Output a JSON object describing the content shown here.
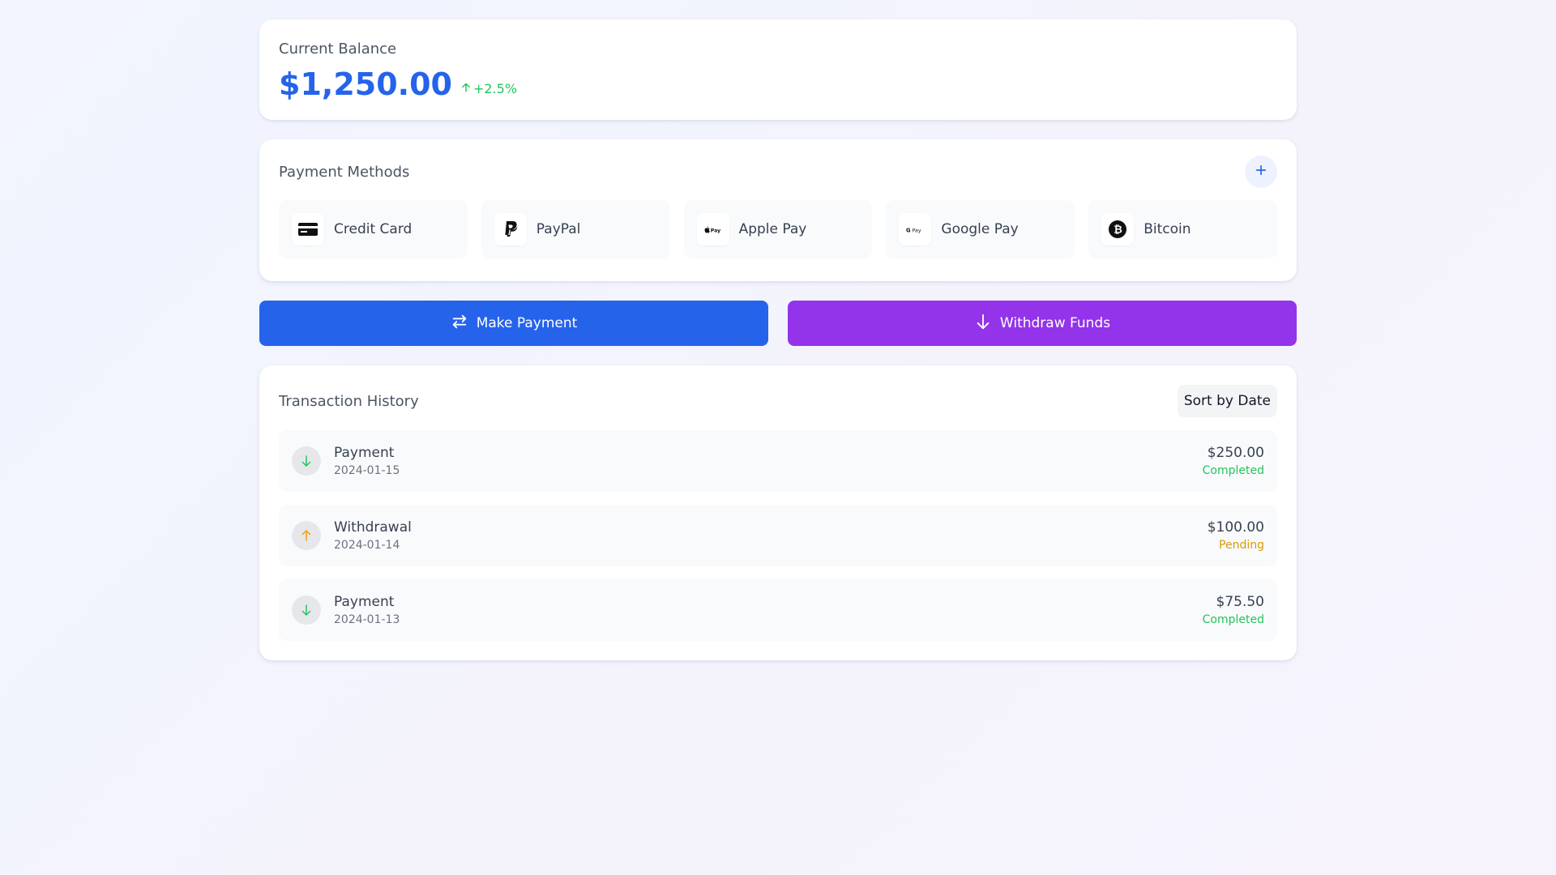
{
  "balance": {
    "label": "Current Balance",
    "amount": "$1,250.00",
    "change": "+2.5%"
  },
  "payment_methods": {
    "title": "Payment Methods",
    "add_icon": "plus-icon",
    "items": [
      {
        "label": "Credit Card",
        "icon": "credit-card-icon"
      },
      {
        "label": "PayPal",
        "icon": "paypal-icon"
      },
      {
        "label": "Apple Pay",
        "icon": "apple-pay-icon"
      },
      {
        "label": "Google Pay",
        "icon": "google-pay-icon"
      },
      {
        "label": "Bitcoin",
        "icon": "bitcoin-icon"
      }
    ]
  },
  "actions": {
    "pay_label": "Make Payment",
    "withdraw_label": "Withdraw Funds"
  },
  "transactions": {
    "title": "Transaction History",
    "sort_label": "Sort by Date",
    "items": [
      {
        "type": "Payment",
        "date": "2024-01-15",
        "amount": "$250.00",
        "status": "Completed",
        "direction": "in"
      },
      {
        "type": "Withdrawal",
        "date": "2024-01-14",
        "amount": "$100.00",
        "status": "Pending",
        "direction": "out"
      },
      {
        "type": "Payment",
        "date": "2024-01-13",
        "amount": "$75.50",
        "status": "Completed",
        "direction": "in"
      }
    ]
  },
  "colors": {
    "primary": "#2563eb",
    "purple": "#9333ea",
    "success": "#22c55e",
    "pending": "#d99a0a"
  }
}
